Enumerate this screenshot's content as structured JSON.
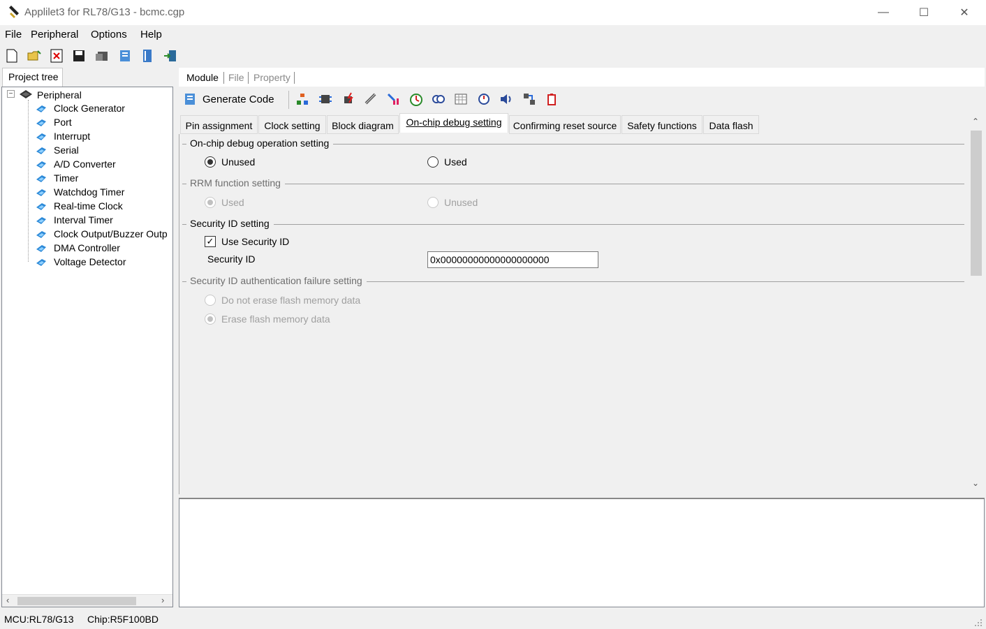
{
  "window": {
    "title": "Applilet3 for RL78/G13 - bcmc.cgp",
    "min_symbol": "—",
    "max_symbol": "☐",
    "close_symbol": "✕"
  },
  "menu": [
    "File",
    "Peripheral",
    "Options",
    "Help"
  ],
  "toolbar_icons": [
    "new-file-icon",
    "open-folder-icon",
    "close-icon",
    "save-icon",
    "save-as-icon",
    "generate-icon",
    "book-icon",
    "export-icon"
  ],
  "left_panel": {
    "tab": "Project tree",
    "root": "Peripheral",
    "expander": "−",
    "items": [
      "Clock Generator",
      "Port",
      "Interrupt",
      "Serial",
      "A/D Converter",
      "Timer",
      "Watchdog Timer",
      "Real-time Clock",
      "Interval Timer",
      "Clock Output/Buzzer Outp",
      "DMA Controller",
      "Voltage Detector"
    ],
    "scroll_left": "‹",
    "scroll_right": "›"
  },
  "module_tabs": [
    "Module",
    "File",
    "Property"
  ],
  "generate_code": "Generate Code",
  "inner_tabs": [
    "Pin assignment",
    "Clock setting",
    "Block diagram",
    "On-chip debug setting",
    "Confirming reset source",
    "Safety functions",
    "Data flash"
  ],
  "active_inner_tab": 3,
  "groups": {
    "ocd": {
      "title": "On-chip debug operation setting",
      "options": [
        "Unused",
        "Used"
      ],
      "selected": 0
    },
    "rrm": {
      "title": "RRM function setting",
      "options": [
        "Used",
        "Unused"
      ],
      "selected": 0
    },
    "secid": {
      "title": "Security ID setting",
      "checkbox_label": "Use Security ID",
      "checkbox_checked": true,
      "check_mark": "✓",
      "field_label": "Security ID",
      "field_value": "0x00000000000000000000"
    },
    "auth": {
      "title": "Security ID authentication failure setting",
      "options": [
        "Do not erase flash memory data",
        "Erase flash memory data"
      ],
      "selected": 1
    }
  },
  "vscroll": {
    "up": "⌃",
    "down": "⌄"
  },
  "status": {
    "mcu": "MCU:RL78/G13",
    "chip": "Chip:R5F100BD"
  }
}
